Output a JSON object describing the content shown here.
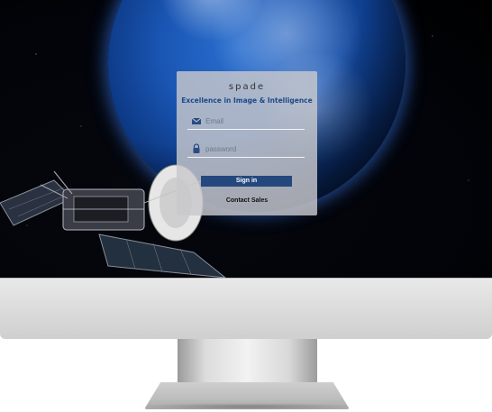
{
  "login": {
    "logo": "spade",
    "tagline": "Excellence in Image & Intelligence",
    "email_placeholder": "Email",
    "password_placeholder": "password",
    "signin_label": "Sign in",
    "contact_label": "Contact Sales"
  },
  "colors": {
    "accent": "#24487e",
    "tagline": "#1d4a86",
    "card": "#c8c8cc"
  },
  "icons": {
    "email": "envelope-icon",
    "password": "lock-icon"
  }
}
